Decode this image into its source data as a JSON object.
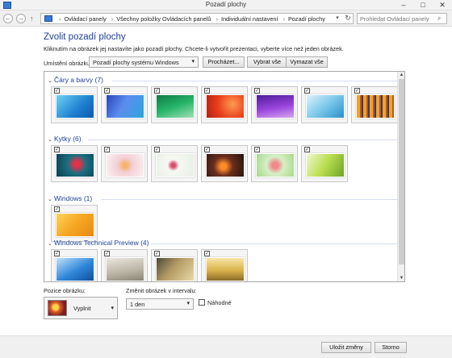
{
  "window": {
    "title": "Pozadí plochy",
    "min_icon": "minimize-icon",
    "max_icon": "maximize-icon",
    "close_icon": "close-icon"
  },
  "nav": {
    "back_glyph": "←",
    "forward_glyph": "→",
    "up_glyph": "↑",
    "breadcrumbs": [
      "Ovládací panely",
      "Všechny položky Ovládacích panelů",
      "Individuální nastavení",
      "Pozadí plochy"
    ],
    "search_placeholder": "Prohledat Ovládací panely"
  },
  "page": {
    "heading": "Zvolit pozadí plochy",
    "instructions": "Kliknutím na obrázek jej nastavíte jako pozadí plochy. Chcete-li vytvořit prezentaci, vyberte více než jeden obrázek.",
    "location_label": "Umístění obrázku:",
    "location_value": "Pozadí plochy systému Windows",
    "browse_label": "Procházet...",
    "select_all_label": "Vybrat vše",
    "clear_all_label": "Vymazat vše"
  },
  "groups": [
    {
      "title": "Čáry a barvy (7)",
      "count": 7,
      "colors": [
        "#2a9fdd",
        "#3d6ed8",
        "#1f9a5a",
        "#e24a1f",
        "#8b35c4",
        "#58b8e8",
        "#d98a2a"
      ]
    },
    {
      "title": "Kytky (6)",
      "count": 6,
      "colors": [
        "#1e6f7a",
        "#f1c2c8",
        "#eef3ea",
        "#6a3b2a",
        "#e9a39a",
        "#b7d64a"
      ]
    },
    {
      "title": "Windows (1)",
      "count": 1,
      "colors": [
        "#f2b01f"
      ]
    },
    {
      "title": "Windows Technical Preview (4)",
      "count": 4,
      "colors": [
        "#2f7fd0",
        "#cfcac0",
        "#9b8a6c",
        "#e5c96a"
      ]
    }
  ],
  "bottom": {
    "position_label": "Pozice obrázku:",
    "position_value": "Vyplnit",
    "interval_label": "Změnit obrázek v intervalu:",
    "interval_value": "1 den",
    "shuffle_label": "Náhodné"
  },
  "footer": {
    "save_label": "Uložit změny",
    "cancel_label": "Storno"
  }
}
